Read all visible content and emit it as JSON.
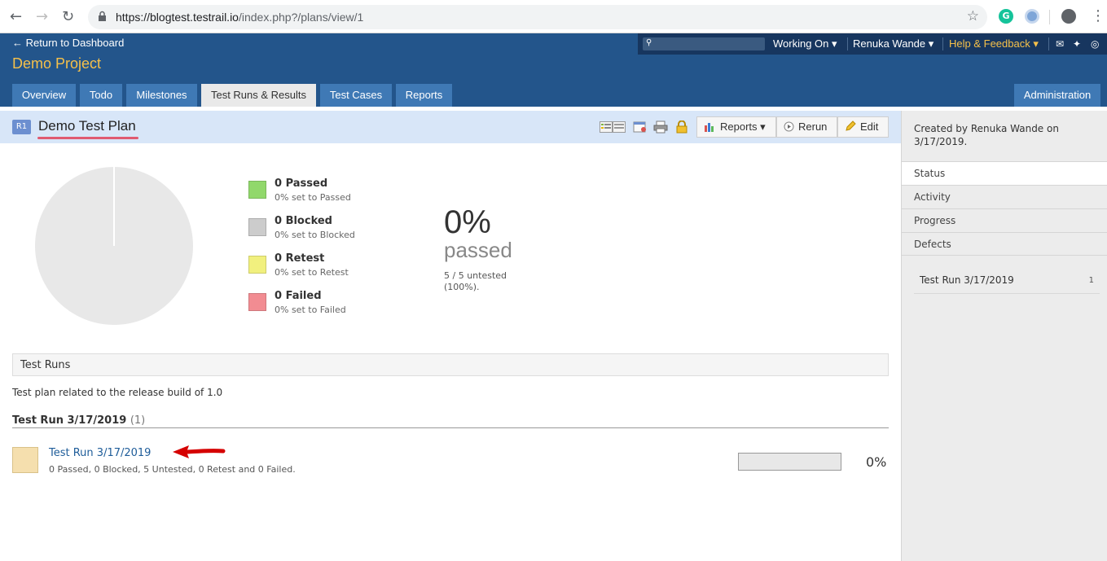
{
  "browser": {
    "url_host": "https://blogtest.testrail.io",
    "url_path": "/index.php?/plans/view/1"
  },
  "header": {
    "return_link": "← Return to Dashboard",
    "project": "Demo Project",
    "working_on": "Working On ▾",
    "user": "Renuka Wande ▾",
    "help": "Help & Feedback ▾",
    "tabs": [
      "Overview",
      "Todo",
      "Milestones",
      "Test Runs & Results",
      "Test Cases",
      "Reports"
    ],
    "admin_tab": "Administration"
  },
  "plan": {
    "badge": "R1",
    "title": "Demo Test Plan",
    "reports_btn": "Reports ▾",
    "rerun_btn": "Rerun",
    "edit_btn": "Edit"
  },
  "stats": {
    "legend": [
      {
        "title": "0 Passed",
        "sub": "0% set to Passed",
        "color": "#91d86b"
      },
      {
        "title": "0 Blocked",
        "sub": "0% set to Blocked",
        "color": "#cccccc"
      },
      {
        "title": "0 Retest",
        "sub": "0% set to Retest",
        "color": "#f1f07e"
      },
      {
        "title": "0 Failed",
        "sub": "0% set to Failed",
        "color": "#f28c92"
      }
    ],
    "percent": "0%",
    "passed_label": "passed",
    "untested_line1": "5 / 5 untested",
    "untested_line2": "(100%)."
  },
  "runs": {
    "section_title": "Test Runs",
    "description": "Test plan related to the release build of 1.0",
    "group_title": "Test Run 3/17/2019",
    "group_count": "(1)",
    "items": [
      {
        "name": "Test Run 3/17/2019",
        "summary": "0 Passed, 0 Blocked, 5 Untested, 0 Retest and 0 Failed.",
        "progress": 0,
        "percent": "0%"
      }
    ]
  },
  "sidebar": {
    "created_by": "Created by Renuka Wande on 3/17/2019.",
    "tabs": [
      "Status",
      "Activity",
      "Progress",
      "Defects"
    ],
    "run_name": "Test Run 3/17/2019",
    "run_count": "1"
  }
}
